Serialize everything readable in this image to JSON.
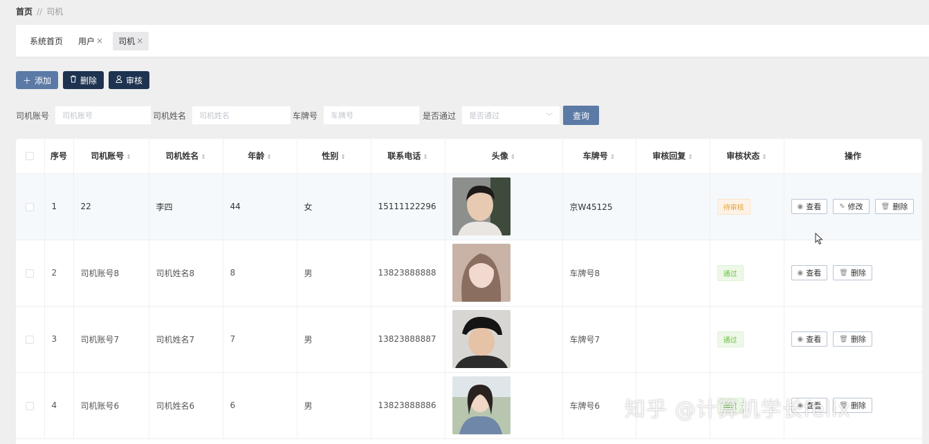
{
  "breadcrumb": {
    "home": "首页",
    "separator": "//",
    "current": "司机"
  },
  "tabs": [
    {
      "label": "系统首页",
      "closable": false,
      "active": false
    },
    {
      "label": "用户",
      "closable": true,
      "active": false
    },
    {
      "label": "司机",
      "closable": true,
      "active": true
    }
  ],
  "tab_close_glyph": "×",
  "toolbar": {
    "add_label": "添加",
    "delete_label": "删除",
    "audit_label": "审核"
  },
  "filters": {
    "account_label": "司机账号",
    "account_placeholder": "司机账号",
    "name_label": "司机姓名",
    "name_placeholder": "司机姓名",
    "plate_label": "车牌号",
    "plate_placeholder": "车牌号",
    "passed_label": "是否通过",
    "passed_placeholder": "是否通过",
    "query_label": "查询"
  },
  "table": {
    "columns": [
      "序号",
      "司机账号",
      "司机姓名",
      "年龄",
      "性别",
      "联系电话",
      "头像",
      "车牌号",
      "审核回复",
      "审核状态",
      "操作"
    ],
    "rows": [
      {
        "index": "1",
        "account": "22",
        "name": "李四",
        "age": "44",
        "gender": "女",
        "phone": "15111122296",
        "plate": "京W45125",
        "reply": "",
        "status": "待审核",
        "actions": [
          "查看",
          "修改",
          "删除"
        ]
      },
      {
        "index": "2",
        "account": "司机账号8",
        "name": "司机姓名8",
        "age": "8",
        "gender": "男",
        "phone": "13823888888",
        "plate": "车牌号8",
        "reply": "",
        "status": "通过",
        "actions": [
          "查看",
          "删除"
        ]
      },
      {
        "index": "3",
        "account": "司机账号7",
        "name": "司机姓名7",
        "age": "7",
        "gender": "男",
        "phone": "13823888887",
        "plate": "车牌号7",
        "reply": "",
        "status": "通过",
        "actions": [
          "查看",
          "删除"
        ]
      },
      {
        "index": "4",
        "account": "司机账号6",
        "name": "司机姓名6",
        "age": "6",
        "gender": "男",
        "phone": "13823888886",
        "plate": "车牌号6",
        "reply": "",
        "status": "通过",
        "actions": [
          "查看",
          "删除"
        ]
      }
    ]
  },
  "colors": {
    "primary": "#5b7aa5",
    "dark": "#1e3350",
    "pending": "#e6a23c",
    "pass": "#67c23a"
  },
  "watermark": "知乎 @计算机学长felix"
}
